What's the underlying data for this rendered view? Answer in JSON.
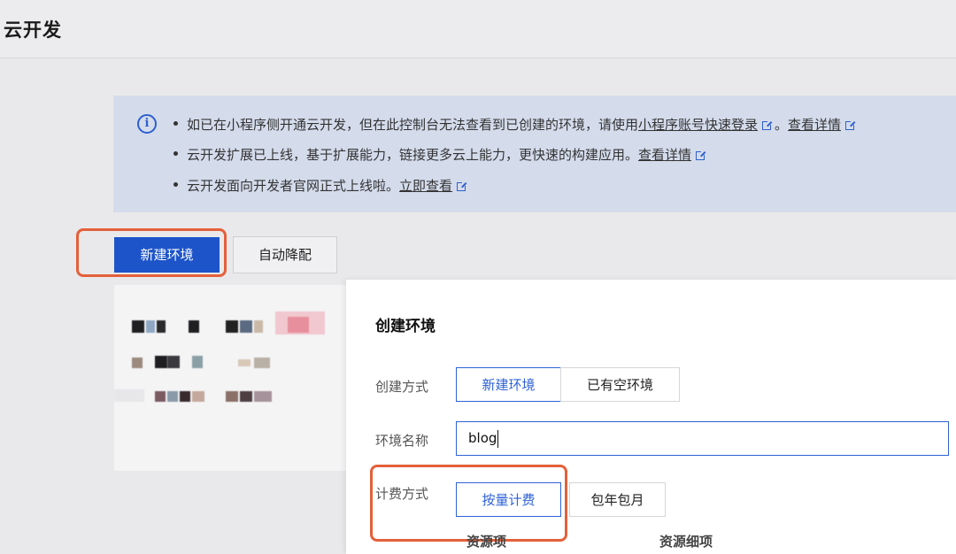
{
  "header": {
    "title": "云开发"
  },
  "notice": {
    "line1": {
      "text": "如已在小程序侧开通云开发，但在此控制台无法查看到已创建的环境，请使用",
      "link1": "小程序账号快速登录",
      "sep": "。",
      "link2": "查看详情"
    },
    "line2": {
      "text": "云开发扩展已上线，基于扩展能力，链接更多云上能力，更快速的构建应用。",
      "link": "查看详情"
    },
    "line3": {
      "text": "云开发面向开发者官网正式上线啦。",
      "link": "立即查看"
    }
  },
  "toolbar": {
    "new_env_label": "新建环境",
    "auto_downgrade_label": "自动降配"
  },
  "dialog": {
    "title": "创建环境",
    "create_method": {
      "label": "创建方式",
      "options": [
        "新建环境",
        "已有空环境"
      ],
      "selected": "新建环境"
    },
    "env_name": {
      "label": "环境名称",
      "value": "blog"
    },
    "billing": {
      "label": "计费方式",
      "options": [
        "按量计费",
        "包年包月"
      ],
      "selected": "按量计费"
    },
    "columns": [
      "资源项",
      "资源细项"
    ]
  },
  "colors": {
    "primary": "#1d54c9",
    "accent_border": "#2e62d6",
    "highlight": "#e4603a",
    "notice_bg": "#d4dcec"
  }
}
